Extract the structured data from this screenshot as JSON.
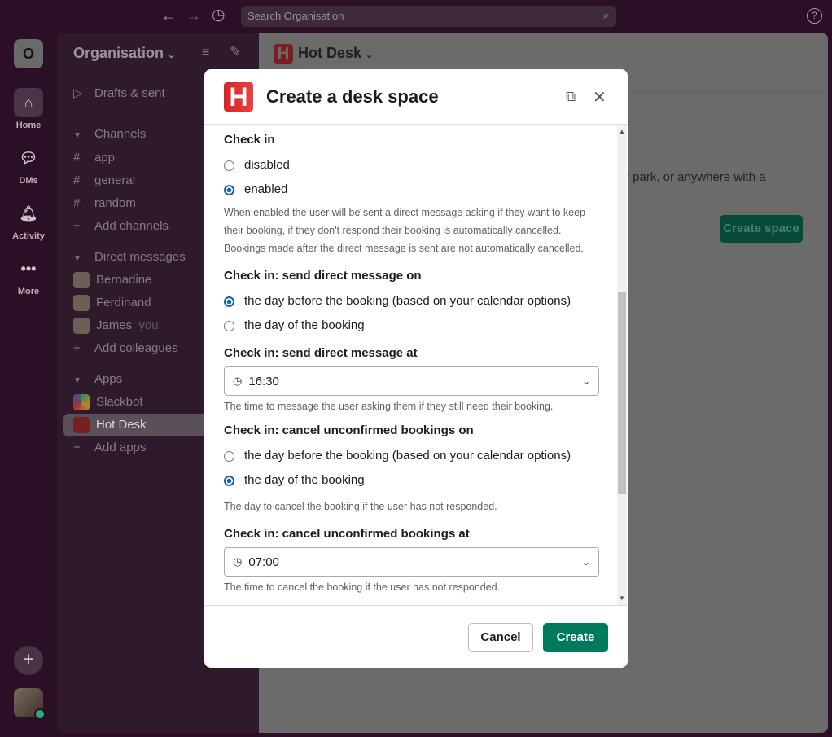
{
  "topbar": {
    "search_placeholder": "Search Organisation",
    "help": "?"
  },
  "rail": {
    "workspace_initial": "O",
    "items": [
      {
        "label": "Home"
      },
      {
        "label": "DMs"
      },
      {
        "label": "Activity"
      },
      {
        "label": "More"
      }
    ]
  },
  "sidebar": {
    "title": "Organisation",
    "drafts": "Drafts & sent",
    "channels_header": "Channels",
    "channels": [
      "app",
      "general",
      "random"
    ],
    "add_channels": "Add channels",
    "dm_header": "Direct messages",
    "dms": [
      "Bernadine",
      "Ferdinand",
      "James"
    ],
    "you_label": "you",
    "add_colleagues": "Add colleagues",
    "apps_header": "Apps",
    "apps": [
      "Slackbot",
      "Hot Desk"
    ],
    "add_apps": "Add apps"
  },
  "main": {
    "title": "Hot Desk",
    "text": "r park, or anywhere with a",
    "create_space": "Create space"
  },
  "modal": {
    "title": "Create a desk space",
    "logo": "H",
    "check_in": {
      "label": "Check in",
      "options": [
        "disabled",
        "enabled"
      ],
      "selected": "enabled",
      "help": "When enabled the user will be sent a direct message asking if they want to keep their booking, if they don't respond their booking is automatically cancelled. Bookings made after the direct message is sent are not automatically cancelled."
    },
    "send_on": {
      "label": "Check in: send direct message on",
      "options": [
        "the day before the booking (based on your calendar options)",
        "the day of the booking"
      ],
      "selected": "the day before the booking (based on your calendar options)"
    },
    "send_at": {
      "label": "Check in: send direct message at",
      "value": "16:30",
      "help": "The time to message the user asking them if they still need their booking."
    },
    "cancel_on": {
      "label": "Check in: cancel unconfirmed bookings on",
      "options": [
        "the day before the booking (based on your calendar options)",
        "the day of the booking"
      ],
      "selected": "the day of the booking",
      "help": "The day to cancel the booking if the user has not responded."
    },
    "cancel_at": {
      "label": "Check in: cancel unconfirmed bookings at",
      "value": "07:00",
      "help": "The time to cancel the booking if the user has not responded."
    },
    "cancel_button": "Cancel",
    "create_button": "Create"
  },
  "colors": {
    "accent": "#007a5a",
    "radio": "#1264a3",
    "brand": "#e0302f"
  }
}
